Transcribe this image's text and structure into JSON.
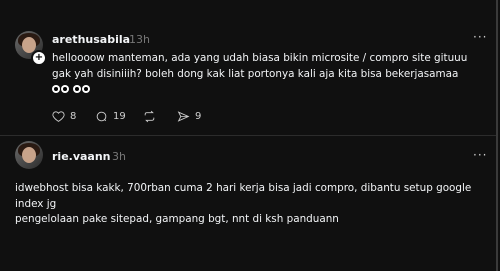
{
  "posts": [
    {
      "username": "arethusabila",
      "time": "13h",
      "text_line1": "helloooow manteman, ada yang udah biasa bikin microsite / compro site gituuu",
      "text_line2": "gak yah disiniiih? boleh dong kak liat portonya kali aja kita bisa bekerjasamaa",
      "emoji": "👀👀",
      "likes": "8",
      "replies": "19",
      "shares": "9",
      "more_label": "···"
    },
    {
      "username": "rie.vaann",
      "time": "3h",
      "text_line1": "idwebhost bisa kakk, 700rban cuma 2 hari kerja bisa jadi compro, dibantu setup google",
      "text_line2": "index jg",
      "text_line3": "pengelolaan pake sitepad, gampang bgt, nnt di ksh panduann",
      "more_label": "···"
    }
  ],
  "icons": {
    "like": "heart-icon",
    "reply": "comment-icon",
    "repost": "repost-icon",
    "share": "send-icon",
    "follow": "plus-icon"
  }
}
